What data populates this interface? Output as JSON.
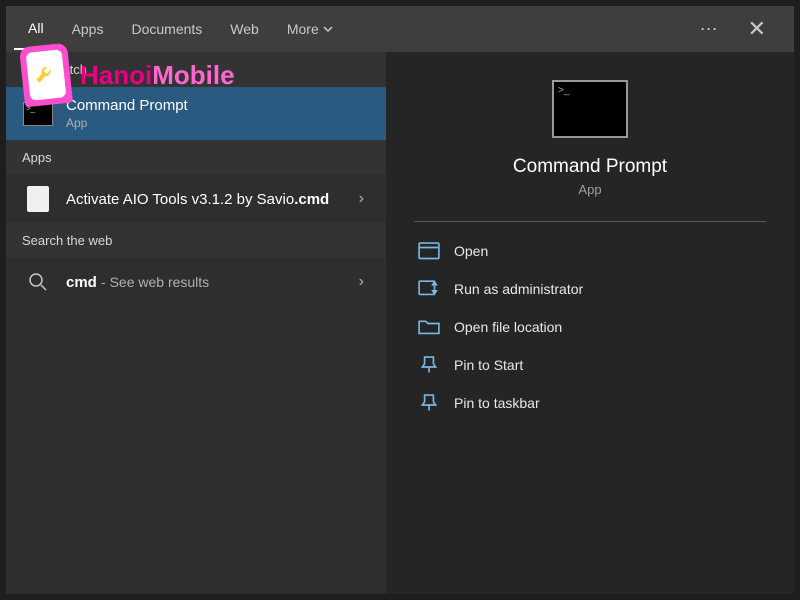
{
  "header": {
    "tabs": [
      {
        "label": "All",
        "active": true
      },
      {
        "label": "Apps",
        "active": false
      },
      {
        "label": "Documents",
        "active": false
      },
      {
        "label": "Web",
        "active": false
      },
      {
        "label": "More",
        "active": false,
        "dropdown": true
      }
    ]
  },
  "sections": {
    "best_match": "Best match",
    "apps": "Apps",
    "search_web": "Search the web"
  },
  "results": {
    "best_match": {
      "title": "Command Prompt",
      "subtitle": "App"
    },
    "apps": [
      {
        "title_prefix": "Activate AIO Tools v3.1.2 by Savio",
        "title_suffix": ".cmd"
      }
    ],
    "web": {
      "query": "cmd",
      "suffix": "See web results"
    }
  },
  "preview": {
    "title": "Command Prompt",
    "subtitle": "App",
    "actions": [
      {
        "icon": "open",
        "label": "Open"
      },
      {
        "icon": "admin",
        "label": "Run as administrator"
      },
      {
        "icon": "folder",
        "label": "Open file location"
      },
      {
        "icon": "pin-start",
        "label": "Pin to Start"
      },
      {
        "icon": "pin-taskbar",
        "label": "Pin to taskbar"
      }
    ]
  },
  "watermark": {
    "text1": "Hanoi",
    "text2": "Mobile"
  }
}
